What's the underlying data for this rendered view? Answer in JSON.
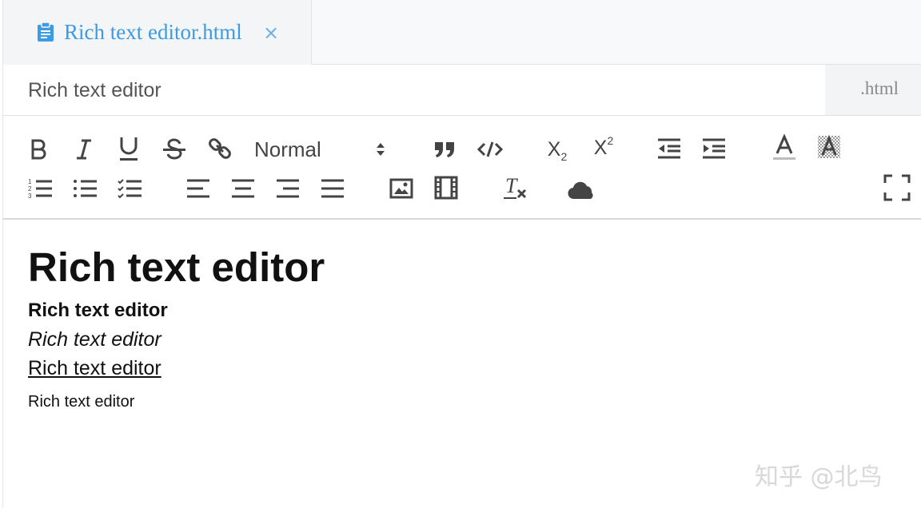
{
  "tab": {
    "label": "Rich text editor.html",
    "close_symbol": "×",
    "icon": "clipboard-icon",
    "accent_color": "#3d9be4"
  },
  "file": {
    "name_value": "Rich text editor",
    "extension": ".html"
  },
  "toolbar": {
    "format_value": "Normal",
    "subscript_base": "X",
    "subscript_mark": "2",
    "superscript_base": "X",
    "superscript_mark": "2",
    "clear_format_glyph": "T",
    "icons": [
      "bold-icon",
      "italic-icon",
      "underline-icon",
      "strike-icon",
      "link-icon",
      "quote-icon",
      "code-icon",
      "subscript-icon",
      "superscript-icon",
      "indent-decrease-icon",
      "indent-increase-icon",
      "font-color-icon",
      "background-color-icon",
      "ordered-list-icon",
      "bullet-list-icon",
      "check-list-icon",
      "align-left-icon",
      "align-center-icon",
      "align-right-icon",
      "align-justify-icon",
      "image-icon",
      "video-icon",
      "clear-format-icon",
      "cloud-icon",
      "fullscreen-icon"
    ]
  },
  "content": {
    "heading": "Rich text editor",
    "bold_line": "Rich text editor",
    "italic_line": "Rich text editor",
    "underline_line": "Rich text editor",
    "plain_line": "Rich text editor"
  },
  "watermark": "知乎 @北鸟"
}
